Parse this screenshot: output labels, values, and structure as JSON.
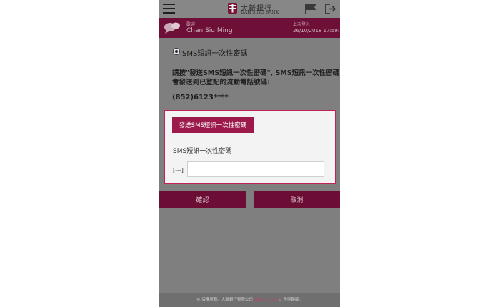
{
  "header": {
    "logo_cn": "大新銀行",
    "logo_en": "DAH SING BANK",
    "icons": {
      "menu": "hamburger-menu-icon",
      "logo": "dah-sing-logo-icon",
      "flag": "flag-icon",
      "logout": "logout-icon"
    }
  },
  "user_bar": {
    "welcome_label": "歡迎！",
    "user_name": "Chan Siu Ming",
    "last_login_label": "上次登入：",
    "last_login_time": "26/10/2018 17:59:15",
    "icon": "chat-bubble-icon"
  },
  "content": {
    "option_label": "SMS短訊一次性密碼",
    "instruction_line1": "請按\"發送SMS短訊一次性密碼\", SMS短訊一次性密碼",
    "instruction_line2": "會發送到已登記的流動電話號碼:",
    "phone_number": "(852)6123****"
  },
  "otp_panel": {
    "send_button_label": "發送SMS短訊一次性密碼",
    "otp_label": "SMS短訊一次性密碼",
    "otp_prefix": "[---]",
    "otp_value": "",
    "otp_placeholder": ""
  },
  "actions": {
    "confirm_label": "確認",
    "cancel_label": "取消"
  },
  "footer": {
    "pre": "© 版權所有。大新銀行有限公司 ",
    "years": "2000 - 2018",
    "post": " 。不得轉載。"
  },
  "colors": {
    "brand": "#9b1a4b",
    "highlight_border": "#c0215b",
    "overlay": "#7f7f7f"
  }
}
